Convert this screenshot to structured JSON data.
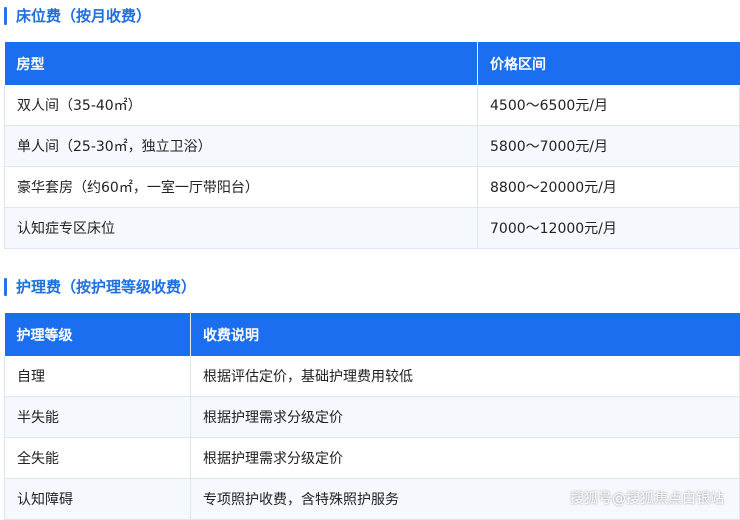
{
  "bed_section": {
    "title": "床位费（按月收费）",
    "headers": [
      "房型",
      "价格区间"
    ],
    "rows": [
      [
        "双人间（35-40㎡）",
        "4500～6500元/月"
      ],
      [
        "单人间（25-30㎡，独立卫浴）",
        "5800～7000元/月"
      ],
      [
        "豪华套房（约60㎡，一室一厅带阳台）",
        "8800～20000元/月"
      ],
      [
        "认知症专区床位",
        "7000～12000元/月"
      ]
    ]
  },
  "care_section": {
    "title": "护理费（按护理等级收费）",
    "headers": [
      "护理等级",
      "收费说明"
    ],
    "rows": [
      [
        "自理",
        "根据评估定价，基础护理费用较低"
      ],
      [
        "半失能",
        "根据护理需求分级定价"
      ],
      [
        "全失能",
        "根据护理需求分级定价"
      ],
      [
        "认知障碍",
        "专项照护收费，含特殊照护服务"
      ]
    ]
  },
  "watermark": "搜狐号@搜狐焦点白银站",
  "colors": {
    "accent": "#1c6ef0",
    "header_text": "#ffffff",
    "stripe": "#f5f8fc"
  }
}
